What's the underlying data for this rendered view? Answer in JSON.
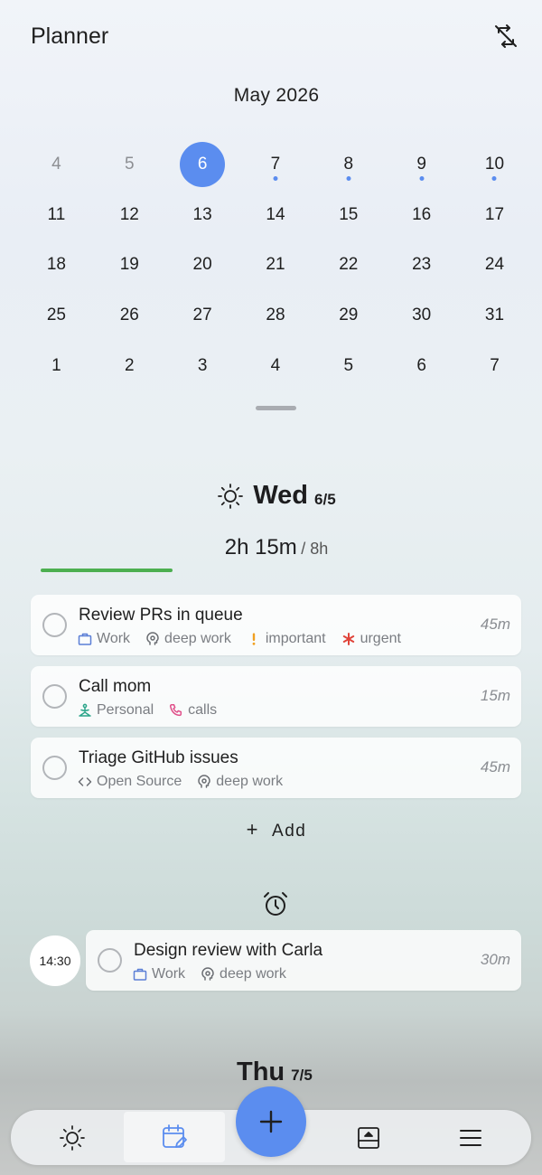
{
  "header": {
    "title": "Planner",
    "sync_icon": "sync-off-icon"
  },
  "calendar": {
    "month_label": "May 2026",
    "weeks": [
      [
        {
          "day": "4",
          "muted": true
        },
        {
          "day": "5",
          "muted": true
        },
        {
          "day": "6",
          "selected": true
        },
        {
          "day": "7",
          "dot": true
        },
        {
          "day": "8",
          "dot": true
        },
        {
          "day": "9",
          "dot": true
        },
        {
          "day": "10",
          "dot": true
        }
      ],
      [
        {
          "day": "11"
        },
        {
          "day": "12"
        },
        {
          "day": "13"
        },
        {
          "day": "14"
        },
        {
          "day": "15"
        },
        {
          "day": "16"
        },
        {
          "day": "17"
        }
      ],
      [
        {
          "day": "18"
        },
        {
          "day": "19"
        },
        {
          "day": "20"
        },
        {
          "day": "21"
        },
        {
          "day": "22"
        },
        {
          "day": "23"
        },
        {
          "day": "24"
        }
      ],
      [
        {
          "day": "25"
        },
        {
          "day": "26"
        },
        {
          "day": "27"
        },
        {
          "day": "28"
        },
        {
          "day": "29"
        },
        {
          "day": "30"
        },
        {
          "day": "31"
        }
      ],
      [
        {
          "day": "1"
        },
        {
          "day": "2"
        },
        {
          "day": "3"
        },
        {
          "day": "4"
        },
        {
          "day": "5"
        },
        {
          "day": "6"
        },
        {
          "day": "7"
        }
      ]
    ]
  },
  "today": {
    "day_name": "Wed",
    "date": "6/5",
    "time_done": "2h 15m",
    "time_total": "/ 8h",
    "progress": 0.28
  },
  "tasks": [
    {
      "title": "Review PRs in queue",
      "duration": "45m",
      "tags": [
        {
          "icon": "briefcase-icon",
          "label": "Work",
          "color": "#5b7fd6"
        },
        {
          "icon": "brain-icon",
          "label": "deep work",
          "color": "#6b6e73"
        },
        {
          "icon": "exclamation-icon",
          "label": "important",
          "color": "#f0a020"
        },
        {
          "icon": "asterisk-icon",
          "label": "urgent",
          "color": "#e0443a"
        }
      ]
    },
    {
      "title": "Call mom",
      "duration": "15m",
      "tags": [
        {
          "icon": "meditation-icon",
          "label": "Personal",
          "color": "#2ba58a"
        },
        {
          "icon": "phone-icon",
          "label": "calls",
          "color": "#e0508a"
        }
      ]
    },
    {
      "title": "Triage GitHub issues",
      "duration": "45m",
      "tags": [
        {
          "icon": "code-icon",
          "label": "Open Source",
          "color": "#6b6e73"
        },
        {
          "icon": "brain-icon",
          "label": "deep work",
          "color": "#6b6e73"
        }
      ]
    }
  ],
  "add_label": "Add",
  "scheduled": {
    "time": "14:30",
    "task": {
      "title": "Design review with Carla",
      "duration": "30m",
      "tags": [
        {
          "icon": "briefcase-icon",
          "label": "Work",
          "color": "#5b7fd6"
        },
        {
          "icon": "brain-icon",
          "label": "deep work",
          "color": "#6b6e73"
        }
      ]
    }
  },
  "next_day": {
    "day_name": "Thu",
    "date": "7/5"
  },
  "nav": {
    "items": [
      {
        "icon": "sun-icon"
      },
      {
        "icon": "calendar-edit-icon",
        "active": true
      },
      {
        "icon": "plus-icon"
      },
      {
        "icon": "inbox-upload-icon"
      },
      {
        "icon": "menu-icon"
      }
    ]
  },
  "colors": {
    "accent": "#5b8def",
    "progress": "#4caf50"
  }
}
